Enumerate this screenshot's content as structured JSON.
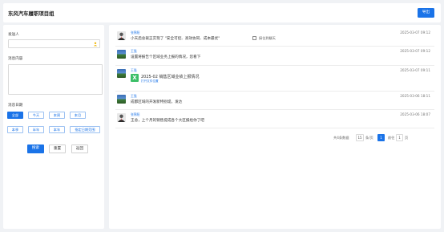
{
  "header": {
    "title": "东风汽车履职项目组",
    "export_label": "导出"
  },
  "filters": {
    "sender_label": "发送人",
    "content_label": "消息内容",
    "date_label": "消息日期",
    "date_buttons": [
      "全部",
      "今天",
      "本周",
      "本月",
      "本季",
      "半年",
      "本年",
      "指定日期范围"
    ],
    "active_date": "全部",
    "search_label": "搜索",
    "reset_label": "重置",
    "back_label": "返回"
  },
  "messages": [
    {
      "sender": "张锦阳",
      "avatar": "person",
      "text": "小天后总裁正实现了 \"安全可控、高效协同、成本最优\"",
      "link_text": "接位到聊天",
      "time": "2025-03-07 09:12"
    },
    {
      "sender": "王强",
      "avatar": "landscape",
      "text": "设置将报告个区域业务上报的情况，您看下",
      "time": "2025-03-07 09:12"
    },
    {
      "sender": "王强",
      "avatar": "landscape",
      "file_name": "2025-02 销售区域业绩上报情况",
      "file_open": "打开文件位置",
      "time": "2025-03-07 09:11"
    },
    {
      "sender": "王强",
      "avatar": "landscape",
      "text": "成都区域的开发新特别堤，发达",
      "time": "2025-03-06 18:11"
    },
    {
      "sender": "张锦阳",
      "avatar": "person",
      "text": "王总，上个月的销售提成各个大区报给你了吧",
      "time": "2025-03-06 18:07"
    }
  ],
  "pagination": {
    "total": "共4条数据",
    "page_size": "15",
    "per_page_label": "条/页",
    "current_page": "1",
    "goto_label": "前往",
    "goto_value": "1",
    "page_unit": "页"
  },
  "colors": {
    "accent": "#1a73e8",
    "file_icon": "#3cbf68"
  }
}
